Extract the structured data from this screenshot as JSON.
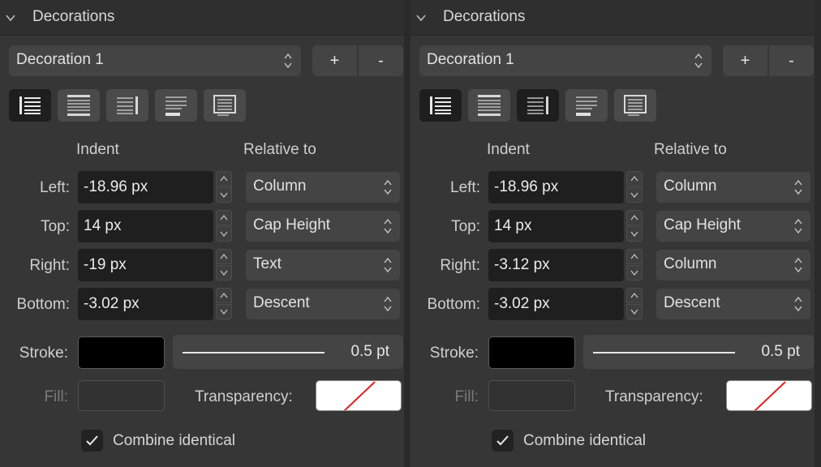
{
  "panels": [
    {
      "header": {
        "title": "Decorations"
      },
      "decoration_select": {
        "value": "Decoration 1"
      },
      "buttons": {
        "add": "+",
        "remove": "-"
      },
      "style_buttons": [
        {
          "name": "border-left-style",
          "active": true
        },
        {
          "name": "border-top-bottom-style",
          "active": false
        },
        {
          "name": "border-right-style",
          "active": false
        },
        {
          "name": "underline-style",
          "active": false
        },
        {
          "name": "box-style",
          "active": false
        }
      ],
      "indent_header": "Indent",
      "relative_header": "Relative to",
      "rows": [
        {
          "label": "Left:",
          "value": "-18.96 px",
          "relative": "Column"
        },
        {
          "label": "Top:",
          "value": "14 px",
          "relative": "Cap Height"
        },
        {
          "label": "Right:",
          "value": "-19 px",
          "relative": "Text"
        },
        {
          "label": "Bottom:",
          "value": "-3.02 px",
          "relative": "Descent"
        }
      ],
      "stroke": {
        "label": "Stroke:",
        "color": "#000000",
        "width": "0.5 pt"
      },
      "fill": {
        "label": "Fill:"
      },
      "transparency": {
        "label": "Transparency:"
      },
      "combine": {
        "label": "Combine identical",
        "checked": true
      }
    },
    {
      "header": {
        "title": "Decorations"
      },
      "decoration_select": {
        "value": "Decoration 1"
      },
      "buttons": {
        "add": "+",
        "remove": "-"
      },
      "style_buttons": [
        {
          "name": "border-left-style",
          "active": true
        },
        {
          "name": "border-top-bottom-style",
          "active": false
        },
        {
          "name": "border-right-style",
          "active": true
        },
        {
          "name": "underline-style",
          "active": false
        },
        {
          "name": "box-style",
          "active": false
        }
      ],
      "indent_header": "Indent",
      "relative_header": "Relative to",
      "rows": [
        {
          "label": "Left:",
          "value": "-18.96 px",
          "relative": "Column"
        },
        {
          "label": "Top:",
          "value": "14 px",
          "relative": "Cap Height"
        },
        {
          "label": "Right:",
          "value": "-3.12 px",
          "relative": "Column"
        },
        {
          "label": "Bottom:",
          "value": "-3.02 px",
          "relative": "Descent"
        }
      ],
      "stroke": {
        "label": "Stroke:",
        "color": "#000000",
        "width": "0.5 pt"
      },
      "fill": {
        "label": "Fill:"
      },
      "transparency": {
        "label": "Transparency:"
      },
      "combine": {
        "label": "Combine identical",
        "checked": true
      }
    }
  ],
  "colors": {
    "panel_bg": "#363636",
    "header_bg": "#2f2f2f",
    "control_bg": "#444444",
    "field_bg": "#1f1f1f",
    "active_button": "#1e1e1e",
    "no_fill_slash": "#e02020"
  }
}
